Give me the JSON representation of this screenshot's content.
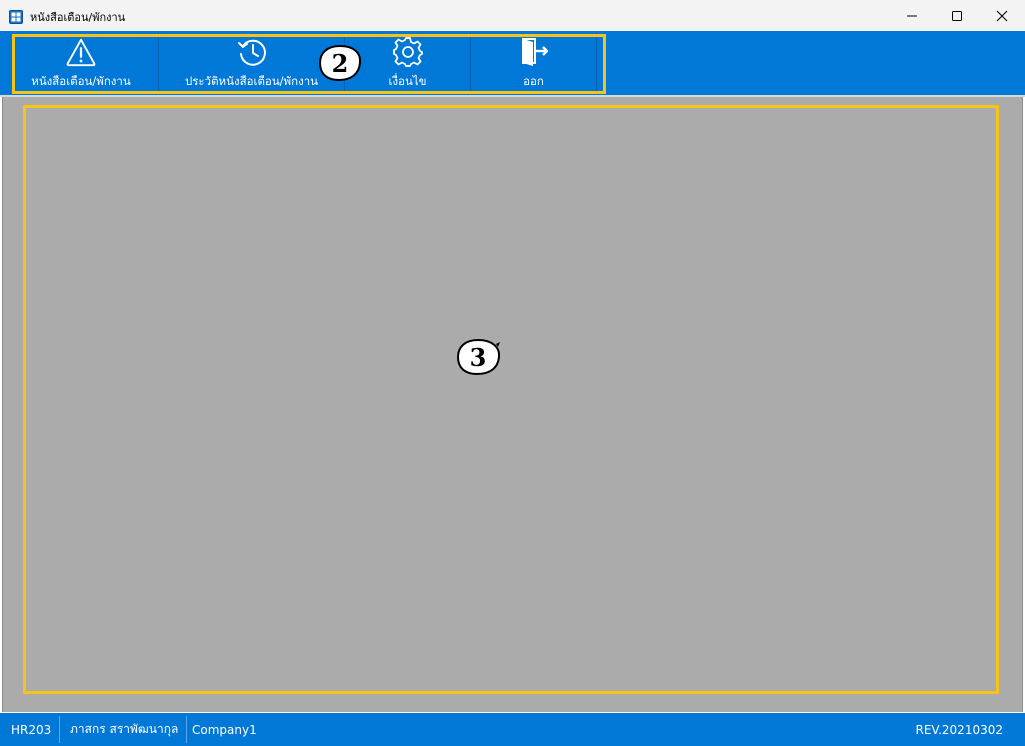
{
  "window": {
    "title": "หนังสือเตือน/พักงาน",
    "controls": [
      "minimize-icon",
      "maximize-icon",
      "close-icon"
    ]
  },
  "toolbar": {
    "buttons": [
      {
        "label": "หนังสือเตือน/พักงาน",
        "icon": "warning-icon"
      },
      {
        "label": "ประวัติหนังสือเตือน/พักงาน",
        "icon": "history-icon"
      },
      {
        "label": "เงื่อนไข",
        "icon": "gear-icon"
      },
      {
        "label": "ออก",
        "icon": "exit-door-icon"
      }
    ]
  },
  "annotations": {
    "toolbar_marker": "2",
    "content_marker": "3",
    "highlight_color": "#f7c31a"
  },
  "status": {
    "code": "HR203",
    "user": "ภาสกร สราพัฒนากุล",
    "company": "Company1",
    "revision": "REV.20210302"
  },
  "colors": {
    "accent": "#0078d7",
    "content_bg": "#ababab",
    "titlebar_bg": "#f3f3f3"
  }
}
